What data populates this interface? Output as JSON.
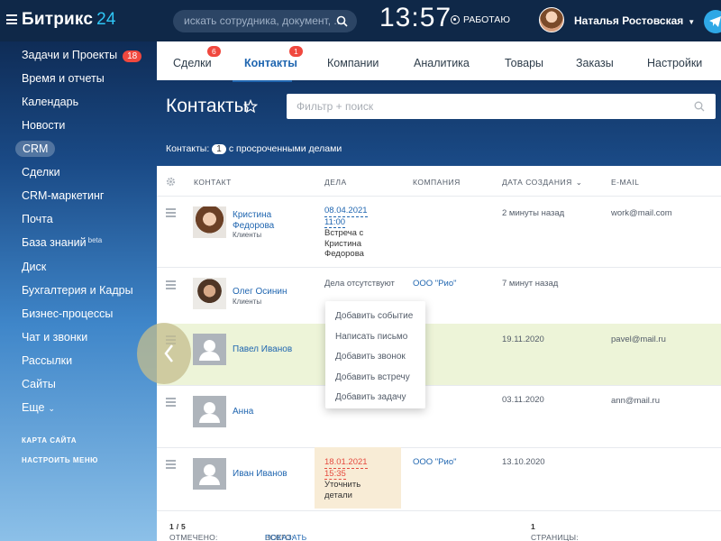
{
  "topbar": {
    "logo_main": "Битрикс",
    "logo_num": "24",
    "search_placeholder": "искать сотрудника, документ, ...",
    "clock": "13:57",
    "work_status": "РАБОТАЮ",
    "user_name": "Наталья Ростовская"
  },
  "sidebar": {
    "items": [
      {
        "label": "Задачи и Проекты",
        "counter": "18"
      },
      {
        "label": "Время и отчеты"
      },
      {
        "label": "Календарь"
      },
      {
        "label": "Новости"
      },
      {
        "label": "CRM"
      },
      {
        "label": "Сделки"
      },
      {
        "label": "CRM-маркетинг"
      },
      {
        "label": "Почта"
      },
      {
        "label": "База знаний",
        "sup": "beta"
      },
      {
        "label": "Диск"
      },
      {
        "label": "Бухгалтерия и Кадры"
      },
      {
        "label": "Бизнес-процессы"
      },
      {
        "label": "Чат и звонки"
      },
      {
        "label": "Рассылки"
      },
      {
        "label": "Сайты"
      },
      {
        "label": "Еще"
      }
    ],
    "sitemap": "КАРТА САЙТА",
    "configure": "НАСТРОИТЬ МЕНЮ"
  },
  "tabs": [
    {
      "label": "Сделки",
      "badge": "6"
    },
    {
      "label": "Контакты",
      "badge": "1"
    },
    {
      "label": "Компании"
    },
    {
      "label": "Аналитика"
    },
    {
      "label": "Товары"
    },
    {
      "label": "Заказы"
    },
    {
      "label": "Настройки"
    }
  ],
  "page": {
    "title": "Контакты",
    "filter_placeholder": "Фильтр + поиск",
    "overdue_prefix": "Контакты:",
    "overdue_count": "1",
    "overdue_suffix": "с просроченными делами"
  },
  "grid": {
    "columns": [
      "КОНТАКТ",
      "ДЕЛА",
      "КОМПАНИЯ",
      "ДАТА СОЗДАНИЯ",
      "E-MAIL"
    ],
    "rows": [
      {
        "name1": "Кристина",
        "name2": "Федорова",
        "type": "Клиенты",
        "deal_date": "08.04.2021",
        "deal_time": "11:00",
        "deal_text1": "Встреча с",
        "deal_text2": "Кристина",
        "deal_text3": "Федорова",
        "company": "",
        "created": "2 минуты назад",
        "email": "work@mail.com"
      },
      {
        "name1": "Олег Осинин",
        "type": "Клиенты",
        "deal_none": "Дела отсутствуют",
        "company": "ООО \"Рио\"",
        "created": "7 минут назад",
        "email": ""
      },
      {
        "name1": "Павел Иванов",
        "created": "19.11.2020",
        "email": "pavel@mail.ru"
      },
      {
        "name1": "Анна",
        "created": "03.11.2020",
        "email": "ann@mail.ru"
      },
      {
        "name1": "Иван Иванов",
        "deal_date": "18.01.2021",
        "deal_time": "15:35",
        "deal_text1": "Уточнить",
        "deal_text2": "детали",
        "company": "ООО \"Рио\"",
        "created": "13.10.2020",
        "email": ""
      }
    ]
  },
  "popup": [
    "Добавить событие",
    "Написать письмо",
    "Добавить звонок",
    "Добавить встречу",
    "Добавить задачу"
  ],
  "footer": {
    "marked_label": "ОТМЕЧЕНО:",
    "marked_value": "1 / 5",
    "total_label": "ВСЕГО:",
    "total_link": "ПОКАЗАТЬ КОЛИЧЕСТВО",
    "pages_label": "СТРАНИЦЫ:",
    "pages_value": "1"
  }
}
